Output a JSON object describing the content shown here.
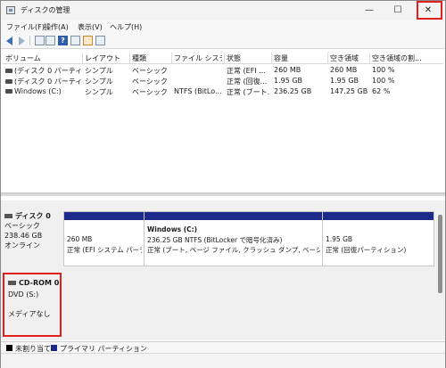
{
  "window": {
    "title": "ディスクの管理",
    "minimize": "—",
    "maximize": "☐",
    "close": "✕"
  },
  "menu": [
    "ファイル(F)",
    "操作(A)",
    "表示(V)",
    "ヘルプ(H)"
  ],
  "toolbar": {
    "help_icon_text": "?"
  },
  "volume_list": {
    "columns": [
      "ボリューム",
      "レイアウト",
      "種類",
      "ファイル システム",
      "状態",
      "容量",
      "空き領域",
      "空き領域の割..."
    ],
    "rows": [
      [
        "(ディスク 0 パーティショ...",
        "シンプル",
        "ベーシック",
        "",
        "正常 (EFI ...",
        "260 MB",
        "260 MB",
        "100 %"
      ],
      [
        "(ディスク 0 パーティショ...",
        "シンプル",
        "ベーシック",
        "",
        "正常 (回復...",
        "1.95 GB",
        "1.95 GB",
        "100 %"
      ],
      [
        "Windows (C:)",
        "シンプル",
        "ベーシック",
        "NTFS (BitLo...",
        "正常 (ブート...",
        "236.25 GB",
        "147.25 GB",
        "62 %"
      ]
    ]
  },
  "disk0": {
    "name": "ディスク 0",
    "type": "ベーシック",
    "size": "238.46 GB",
    "status": "オンライン",
    "partitions": [
      {
        "title": "",
        "line1": "260 MB",
        "line2": "正常 (EFI システム パーティ"
      },
      {
        "title": "Windows  (C:)",
        "line1": "236.25 GB NTFS (BitLocker で暗号化済み)",
        "line2": "正常 (ブート, ページ ファイル, クラッシュ ダンプ, ベーシック データ"
      },
      {
        "title": "",
        "line1": "1.95 GB",
        "line2": "正常 (回復パーティション)"
      }
    ]
  },
  "cdrom": {
    "name": "CD-ROM 0",
    "drive": "DVD (S:)",
    "media": "メディアなし"
  },
  "legend": [
    {
      "label": "未割り当て",
      "color": "#000000"
    },
    {
      "label": "プライマリ パーティション",
      "color": "#1e2a8a"
    }
  ],
  "colors": {
    "highlight": "#e0201a",
    "partition_bar": "#1e2a8a"
  }
}
